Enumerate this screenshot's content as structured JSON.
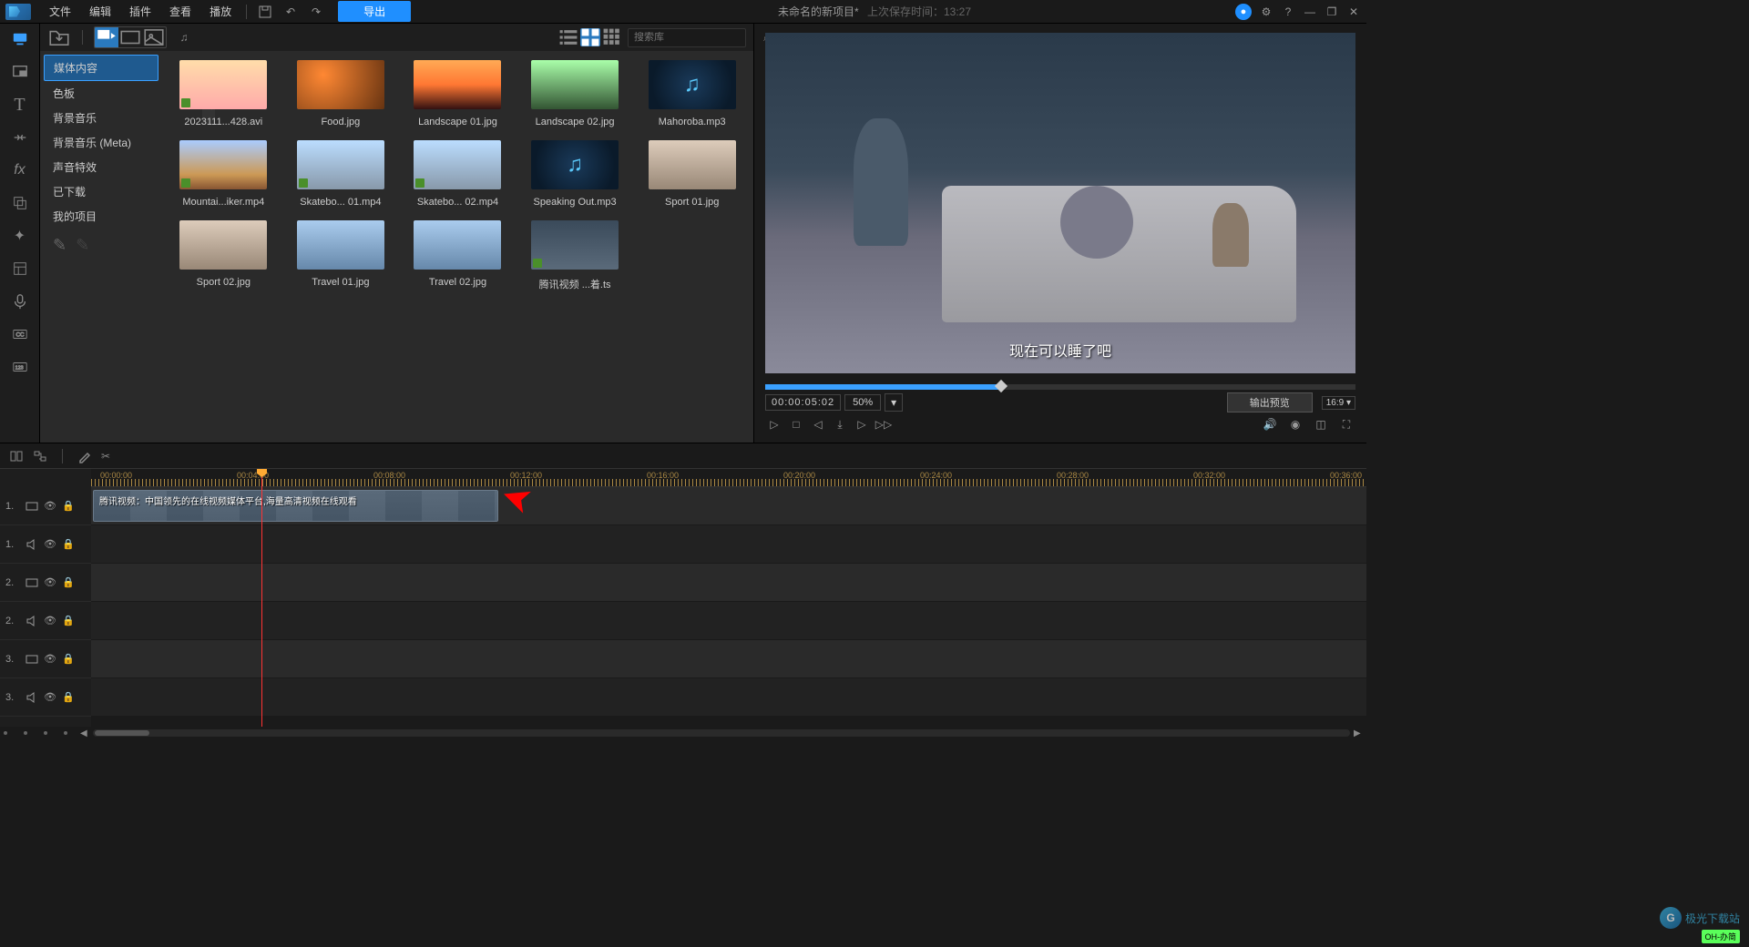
{
  "menu": {
    "file": "文件",
    "edit": "编辑",
    "plugin": "插件",
    "view": "查看",
    "play": "播放",
    "export": "导出"
  },
  "title": {
    "project": "未命名的新项目*",
    "saved_prefix": "上次保存时间：",
    "saved_time": "13:27"
  },
  "sidebar": {
    "items": [
      "媒体内容",
      "色板",
      "背景音乐",
      "背景音乐 (Meta)",
      "声音特效",
      "已下载",
      "我的项目"
    ]
  },
  "search": {
    "placeholder": "搜索库"
  },
  "media": [
    {
      "label": "2023111...428.avi",
      "type": "video",
      "cls": "tc-anime"
    },
    {
      "label": "Food.jpg",
      "type": "image",
      "cls": "tc-food"
    },
    {
      "label": "Landscape 01.jpg",
      "type": "image",
      "cls": "tc-land1"
    },
    {
      "label": "Landscape 02.jpg",
      "type": "image",
      "cls": "tc-land2"
    },
    {
      "label": "Mahoroba.mp3",
      "type": "audio",
      "cls": ""
    },
    {
      "label": "Mountai...iker.mp4",
      "type": "video",
      "cls": "tc-mount"
    },
    {
      "label": "Skatebo... 01.mp4",
      "type": "video",
      "cls": "tc-skate"
    },
    {
      "label": "Skatebo... 02.mp4",
      "type": "video",
      "cls": "tc-skate"
    },
    {
      "label": "Speaking Out.mp3",
      "type": "audio",
      "cls": ""
    },
    {
      "label": "Sport 01.jpg",
      "type": "image",
      "cls": "tc-sport"
    },
    {
      "label": "Sport 02.jpg",
      "type": "image",
      "cls": "tc-sport"
    },
    {
      "label": "Travel 01.jpg",
      "type": "image",
      "cls": "tc-travel"
    },
    {
      "label": "Travel 02.jpg",
      "type": "image",
      "cls": "tc-travel"
    },
    {
      "label": "腾讯视频 ...着.ts",
      "type": "video",
      "cls": "tc-video"
    }
  ],
  "preview": {
    "subtitle": "现在可以睡了吧",
    "timecode": "00:00:05:02",
    "zoom": "50%",
    "output_btn": "输出预览",
    "aspect": "16:9"
  },
  "timeline": {
    "ticks": [
      "00:00:00",
      "00:04:00",
      "00:08:00",
      "00:12:00",
      "00:16:00",
      "00:20:00",
      "00:24:00",
      "00:28:00",
      "00:32:00",
      "00:36:00"
    ],
    "tracks": [
      {
        "num": "1.",
        "type": "video"
      },
      {
        "num": "1.",
        "type": "audio"
      },
      {
        "num": "2.",
        "type": "video"
      },
      {
        "num": "2.",
        "type": "audio"
      },
      {
        "num": "3.",
        "type": "video"
      },
      {
        "num": "3.",
        "type": "audio"
      }
    ],
    "clip_label": "腾讯视频：中国领先的在线视频媒体平台,海量高清视频在线观看"
  },
  "watermark": {
    "site": "极光下载站",
    "badge": "OH-办简"
  }
}
